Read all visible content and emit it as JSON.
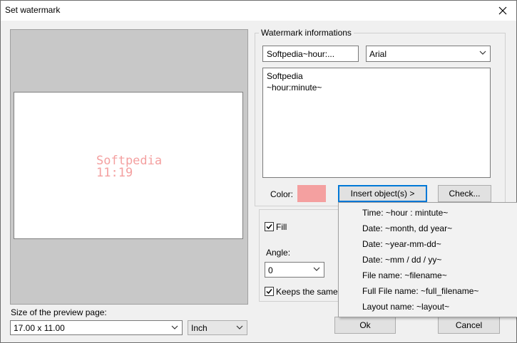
{
  "window": {
    "title": "Set watermark"
  },
  "preview": {
    "line1": "Softpedia",
    "line2": "11:19",
    "text_color": "#f4a0a0"
  },
  "watermark": {
    "group_label": "Watermark informations",
    "name_field": "Softpedia~hour:...",
    "font": "Arial",
    "text_line1": "Softpedia",
    "text_line2": "~hour:minute~",
    "color_label": "Color:",
    "color_swatch": "#f4a0a0",
    "insert_button": "Insert object(s) >",
    "check_button": "Check..."
  },
  "options": {
    "fill_label": "Fill",
    "fill_checked": true,
    "angle_label": "Angle:",
    "angle_value": "0",
    "keeps_label": "Keeps the same",
    "keeps_checked": true
  },
  "insert_menu": [
    "Time: ~hour : mintute~",
    "Date: ~month, dd year~",
    "Date: ~year-mm-dd~",
    "Date: ~mm / dd / yy~",
    "File name: ~filename~",
    "Full File name: ~full_filename~",
    "Layout name: ~layout~"
  ],
  "footer": {
    "size_label": "Size of the preview page:",
    "size_value": "17.00 x 11.00",
    "unit_value": "Inch",
    "ok_button": "Ok",
    "cancel_button": "Cancel"
  }
}
